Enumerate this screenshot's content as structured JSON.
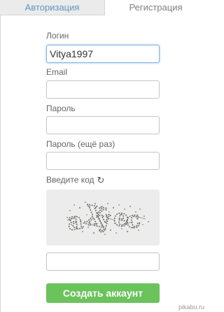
{
  "tabs": {
    "login": "Авторизация",
    "register": "Регистрация"
  },
  "form": {
    "login_label": "Логин",
    "login_value": "Vitya1997",
    "email_label": "Email",
    "email_value": "",
    "password_label": "Пароль",
    "password_value": "",
    "password_repeat_label": "Пароль (ещё раз)",
    "password_repeat_value": "",
    "captcha_label": "Введите код",
    "captcha_reload_icon": "refresh-icon",
    "captcha_text": "aXyec",
    "captcha_value": "",
    "submit_label": "Создать аккаунт"
  },
  "watermark": "pikabu.ru",
  "colors": {
    "tab_active_text": "#808080",
    "tab_inactive_text": "#5b95c7",
    "submit_bg": "#6bc35c"
  }
}
